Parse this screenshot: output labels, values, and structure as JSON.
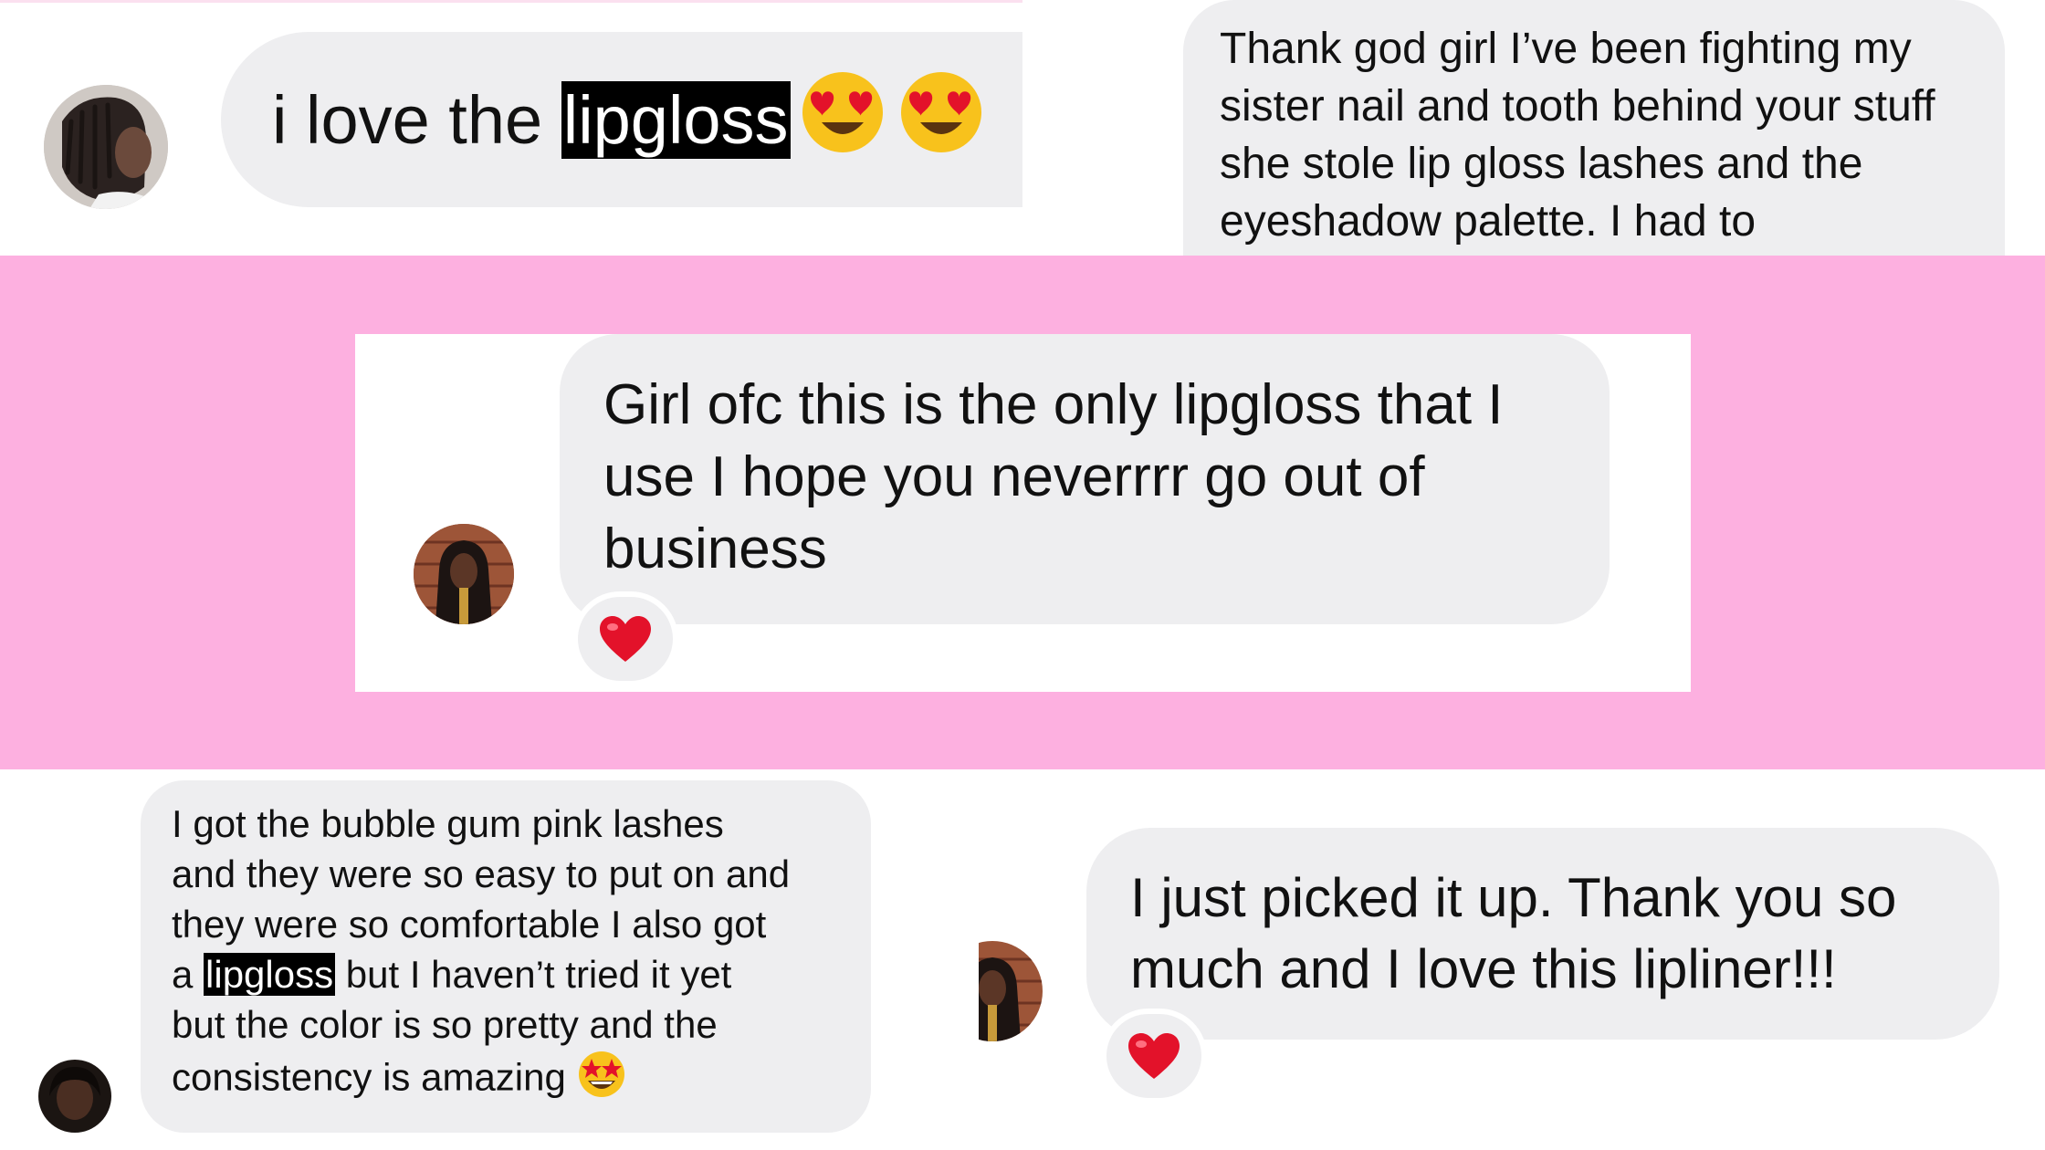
{
  "messages": [
    {
      "id": "msg1",
      "before": "i love the ",
      "highlight": "lipgloss",
      "after": "",
      "emoji": [
        "heart-eyes",
        "heart-eyes"
      ]
    },
    {
      "id": "msg2",
      "text": "Thank god girl I’ve been fighting my sister nail and tooth behind your stuff she stole lip gloss lashes and the eyeshadow palette. I had to"
    },
    {
      "id": "msg3",
      "text": "Girl ofc this is the only lipgloss that I use I hope you neverrrr go out of business",
      "reaction": "red-heart"
    },
    {
      "id": "msg4",
      "line1": "I got the bubble gum pink lashes",
      "line2": "and they were so easy to put on and",
      "line3": "they were so comfortable I also got",
      "line4_before": "a ",
      "line4_highlight": "lipgloss",
      "line4_after": " but I haven’t tried it yet",
      "line5": "but the color is so pretty and the",
      "line6": "consistency is amazing ",
      "emoji": "star-struck"
    },
    {
      "id": "msg5",
      "text": "I just picked it up. Thank you so much and I love this lipliner!!!",
      "reaction": "red-heart"
    }
  ],
  "colors": {
    "background_band": "#fdb0e0",
    "bubble": "#eeeef0",
    "highlight": "#000000",
    "heart": "#e3122a",
    "emoji_face": "#f8c21c"
  }
}
